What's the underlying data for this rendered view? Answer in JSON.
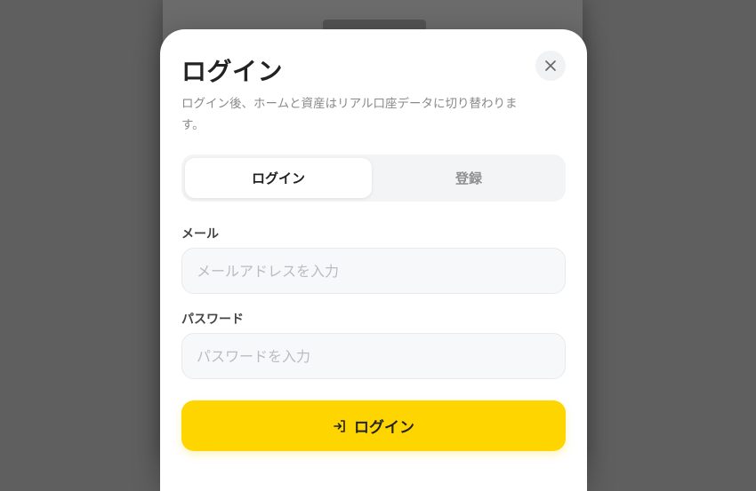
{
  "modal": {
    "title": "ログイン",
    "subtitle": "ログイン後、ホームと資産はリアル口座データに切り替わります。",
    "close_icon": "close-icon"
  },
  "tabs": [
    {
      "label": "ログイン",
      "active": true
    },
    {
      "label": "登録",
      "active": false
    }
  ],
  "form": {
    "email_label": "メール",
    "email_placeholder": "メールアドレスを入力",
    "email_value": "",
    "password_label": "パスワード",
    "password_placeholder": "パスワードを入力",
    "password_value": ""
  },
  "submit": {
    "label": "ログイン",
    "icon": "login-icon"
  },
  "colors": {
    "accent": "#ffd500",
    "overlay": "#5f5f5f"
  }
}
